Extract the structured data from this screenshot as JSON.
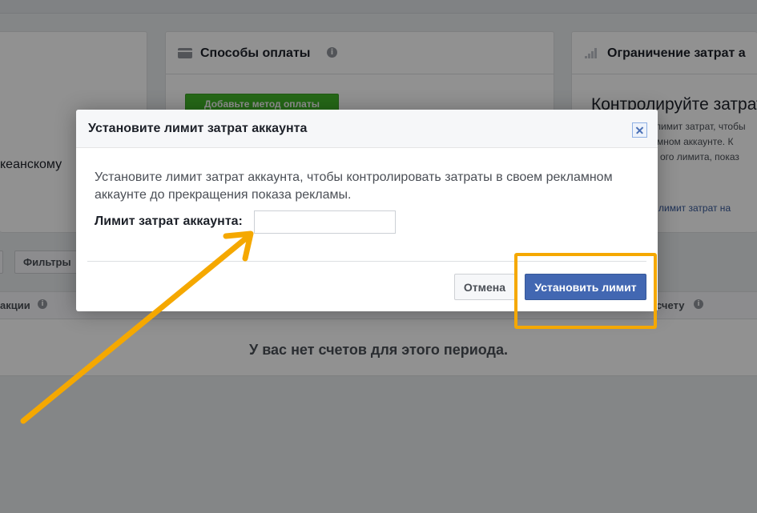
{
  "background": {
    "left_card": {
      "text": "кеанскому"
    },
    "payment_card": {
      "title": "Способы оплаты",
      "info": "i",
      "add_method_label": "Добавьте метод оплаты"
    },
    "spend_card": {
      "title": "Ограничение затрат а",
      "heading": "Контролируйте затрат",
      "desc_lines": [
        "лимит затрат, чтобы",
        "мном аккаунте. К",
        "ого лимита, показ"
      ],
      "link": "лимит затрат на"
    },
    "toolbar": {
      "filters_label": "Фильтры"
    },
    "table": {
      "col_left": "акции",
      "col_right": "счету",
      "info": "i",
      "empty_message": "У вас нет счетов для этого периода."
    }
  },
  "modal": {
    "title": "Установите лимит затрат аккаунта",
    "description": "Установите лимит затрат аккаунта, чтобы контролировать затраты в своем рекламном аккаунте до прекращения показа рекламы.",
    "limit_label": "Лимит затрат аккаунта:",
    "limit_value": "",
    "cancel_label": "Отмена",
    "set_limit_label": "Установить лимит"
  },
  "annotations": {
    "color": "#f5a800",
    "arrow_icon": "arrow-icon",
    "highlight": "highlight-box"
  },
  "icons": {
    "payment": "credit-card-icon",
    "spend": "signal-bars-icon",
    "close": "close-icon",
    "info": "info-icon"
  }
}
